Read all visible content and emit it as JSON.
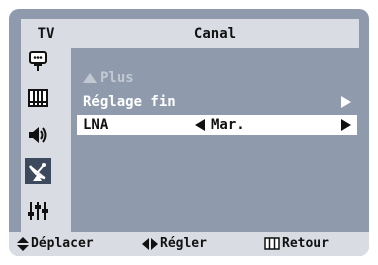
{
  "header": {
    "left_label": "TV",
    "title": "Canal"
  },
  "sidebar": {
    "icons": [
      {
        "name": "tv-input-icon",
        "selected": false
      },
      {
        "name": "picture-icon",
        "selected": false
      },
      {
        "name": "sound-icon",
        "selected": false
      },
      {
        "name": "channel-antenna-icon",
        "selected": true
      },
      {
        "name": "setup-sliders-icon",
        "selected": false
      }
    ]
  },
  "menu": {
    "items": [
      {
        "label": "Plus",
        "state": "disabled"
      },
      {
        "label": "Réglage fin",
        "state": "normal"
      },
      {
        "label": "LNA",
        "value": "Mar.",
        "state": "selected"
      }
    ]
  },
  "footer": {
    "move_label": "Déplacer",
    "adjust_label": "Régler",
    "return_label": "Retour"
  },
  "colors": {
    "panel": "#8f9bad",
    "light": "#d9dde3",
    "selected_icon_bg": "#3d4a5e",
    "highlight": "#ffffff"
  }
}
